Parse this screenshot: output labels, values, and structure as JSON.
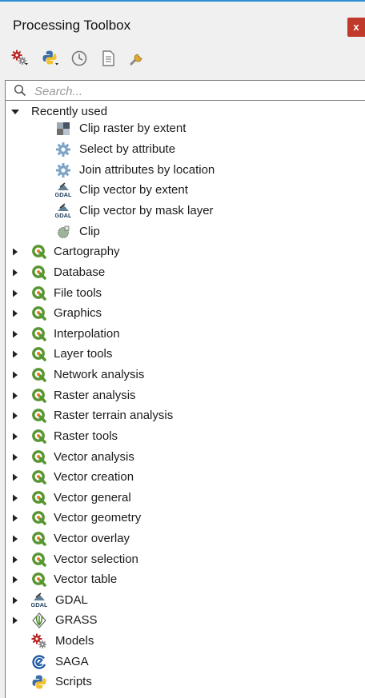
{
  "panel": {
    "title": "Processing Toolbox",
    "close_label": "x"
  },
  "toolbar": {
    "icons": [
      "models-icon",
      "python-scripts-icon",
      "history-icon",
      "results-viewer-icon",
      "options-icon"
    ]
  },
  "search": {
    "placeholder": "Search...",
    "value": ""
  },
  "recently_used": {
    "label": "Recently used",
    "items": [
      {
        "label": "Clip raster by extent",
        "icon": "raster-clip-icon"
      },
      {
        "label": "Select by attribute",
        "icon": "gear-icon"
      },
      {
        "label": "Join attributes by location",
        "icon": "gear-icon"
      },
      {
        "label": "Clip vector by extent",
        "icon": "gdal-icon"
      },
      {
        "label": "Clip vector by mask layer",
        "icon": "gdal-icon"
      },
      {
        "label": "Clip",
        "icon": "clip-icon"
      }
    ]
  },
  "groups": [
    {
      "label": "Cartography"
    },
    {
      "label": "Database"
    },
    {
      "label": "File tools"
    },
    {
      "label": "Graphics"
    },
    {
      "label": "Interpolation"
    },
    {
      "label": "Layer tools"
    },
    {
      "label": "Network analysis"
    },
    {
      "label": "Raster analysis"
    },
    {
      "label": "Raster terrain analysis"
    },
    {
      "label": "Raster tools"
    },
    {
      "label": "Vector analysis"
    },
    {
      "label": "Vector creation"
    },
    {
      "label": "Vector general"
    },
    {
      "label": "Vector geometry"
    },
    {
      "label": "Vector overlay"
    },
    {
      "label": "Vector selection"
    },
    {
      "label": "Vector table"
    }
  ],
  "providers": [
    {
      "label": "GDAL",
      "icon": "gdal-icon"
    },
    {
      "label": "GRASS",
      "icon": "grass-icon"
    }
  ],
  "extras": [
    {
      "label": "Models",
      "icon": "models-icon"
    },
    {
      "label": "SAGA",
      "icon": "saga-icon"
    },
    {
      "label": "Scripts",
      "icon": "python-icon"
    }
  ],
  "colors": {
    "qgis_green": "#589632",
    "qgis_yellow": "#ee7913",
    "close_red": "#c0392b",
    "accent_blue": "#2f8fd6"
  }
}
